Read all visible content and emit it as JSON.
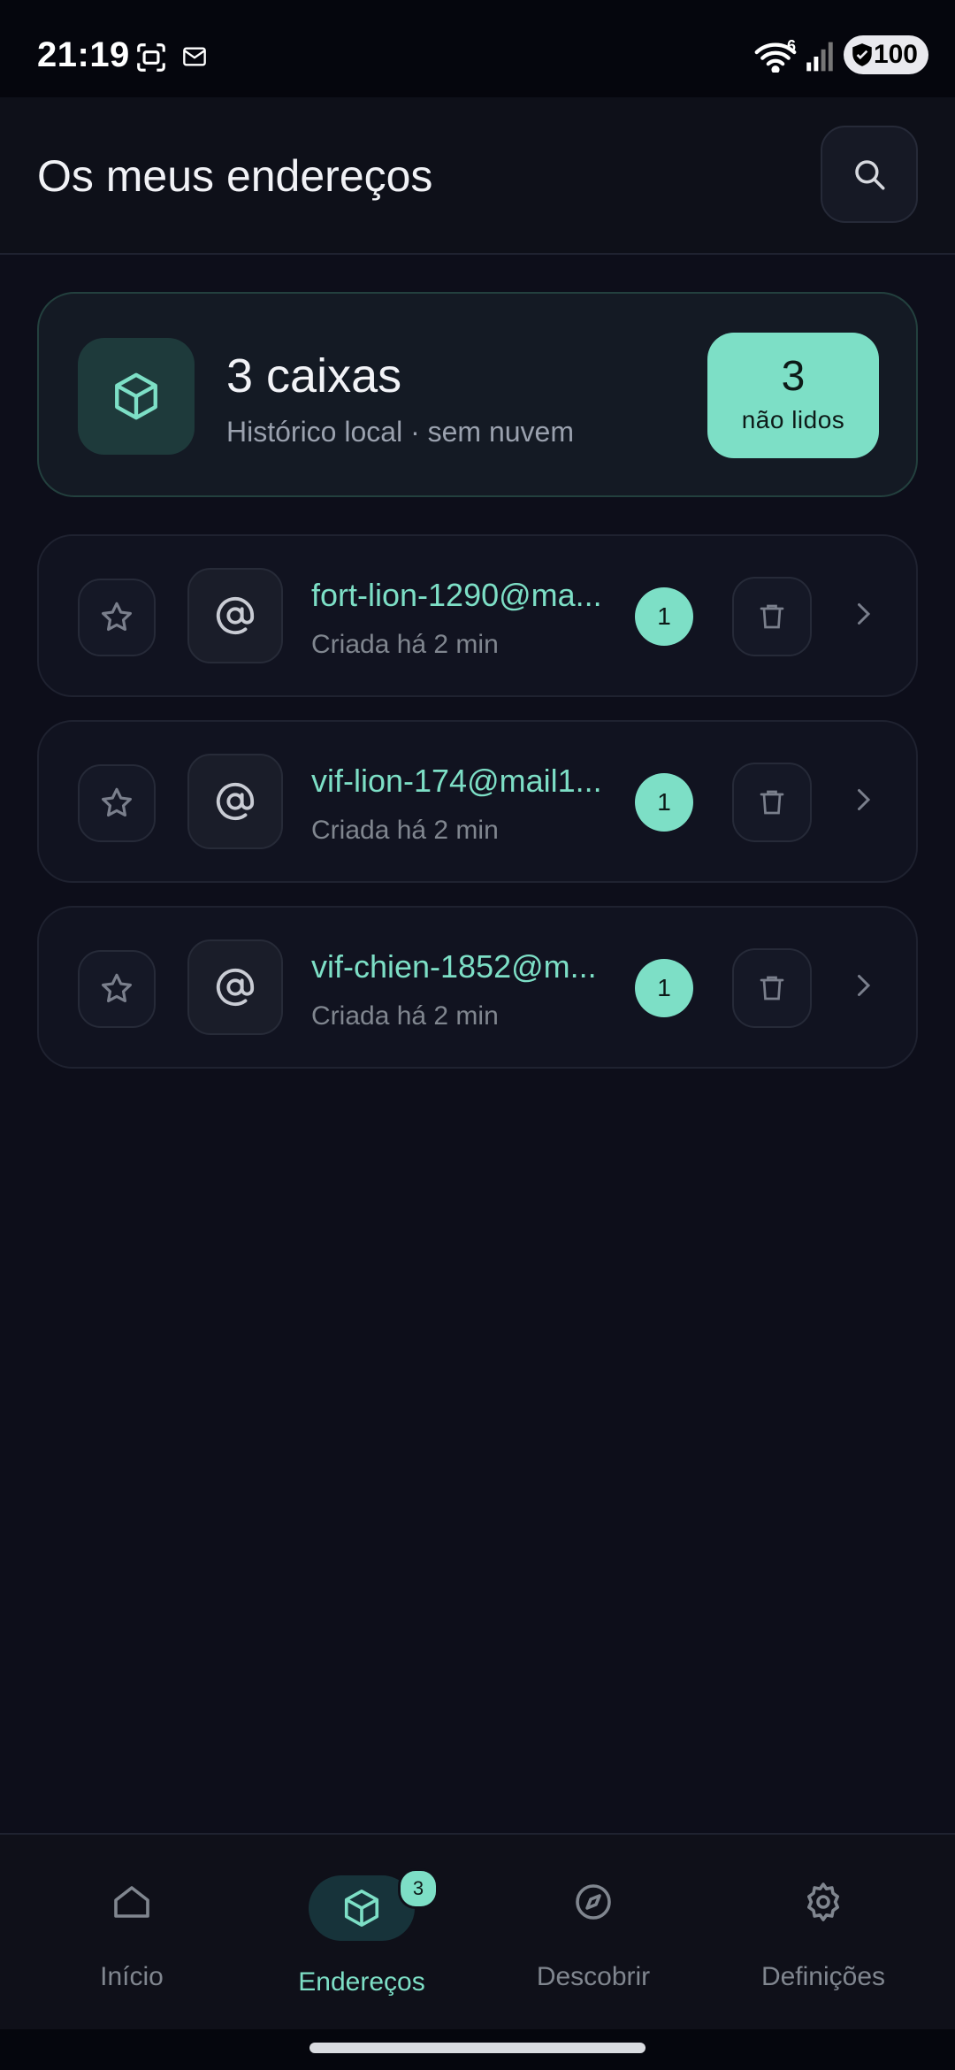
{
  "status_bar": {
    "time": "21:19",
    "network_badge": "6",
    "battery": "100",
    "icons": [
      "screenshot-icon",
      "mail-icon",
      "wifi-icon",
      "signal-icon",
      "battery-icon"
    ]
  },
  "header": {
    "title": "Os meus endereços",
    "search_icon": "search-icon"
  },
  "summary": {
    "title": "3 caixas",
    "subtitle": "Histórico local · sem nuvem",
    "unread_count": "3",
    "unread_label": "não lidos",
    "icon": "box-icon"
  },
  "addresses": [
    {
      "address": "fort-lion-1290@ma...",
      "created": "Criada há 2 min",
      "unread": "1"
    },
    {
      "address": "vif-lion-174@mail1...",
      "created": "Criada há 2 min",
      "unread": "1"
    },
    {
      "address": "vif-chien-1852@m...",
      "created": "Criada há 2 min",
      "unread": "1"
    }
  ],
  "bottom_nav": {
    "items": [
      {
        "label": "Início",
        "icon": "home-icon",
        "active": false
      },
      {
        "label": "Endereços",
        "icon": "box-icon",
        "active": true,
        "badge": "3"
      },
      {
        "label": "Descobrir",
        "icon": "compass-icon",
        "active": false
      },
      {
        "label": "Definições",
        "icon": "gear-icon",
        "active": false
      }
    ]
  },
  "colors": {
    "background": "#0d0e1a",
    "accent": "#7ddfc6",
    "card": "#111320",
    "muted_text": "#80868f"
  }
}
